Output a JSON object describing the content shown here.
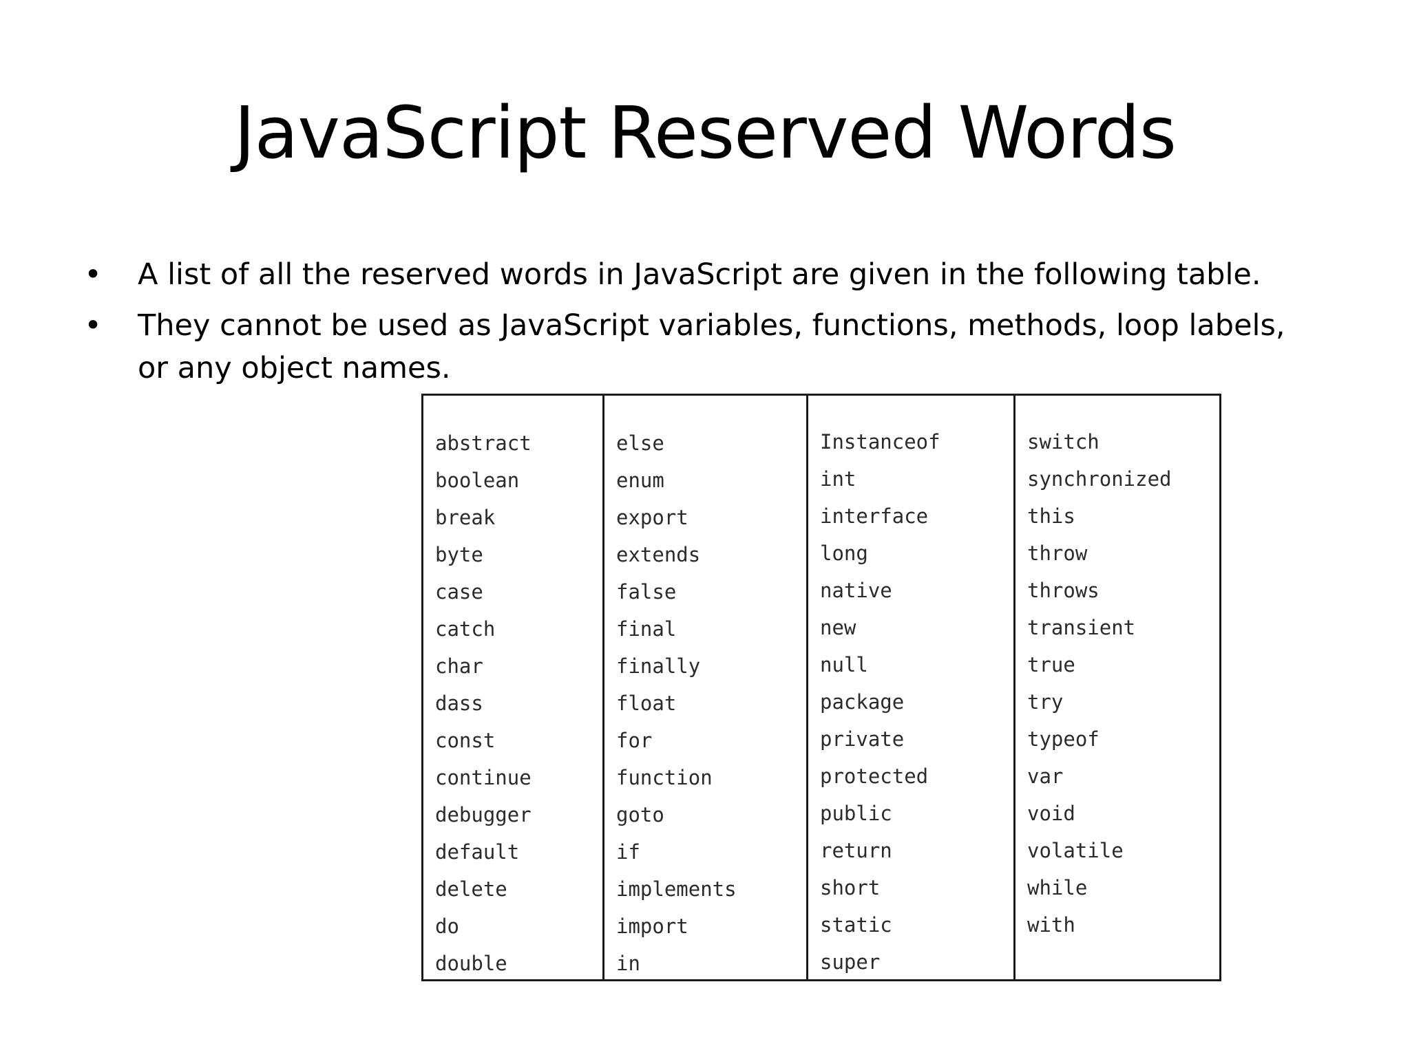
{
  "slide": {
    "title": "JavaScript Reserved Words",
    "bullets": [
      "A list of all the  reserved words in JavaScript  are given in the following table.",
      "They cannot be used as JavaScript variables, functions, methods, loop labels, or any object names."
    ],
    "bullet_symbol": "•"
  },
  "table": {
    "columns": [
      [
        "abstract",
        "boolean",
        "break",
        "byte",
        "case",
        "catch",
        "char",
        "dass",
        "const",
        "continue",
        "debugger",
        "default",
        "delete",
        "do",
        "double"
      ],
      [
        "else",
        "enum",
        "export",
        "extends",
        "false",
        "final",
        "finally",
        "float",
        "for",
        "function",
        "goto",
        "if",
        "implements",
        "import",
        "in"
      ],
      [
        "Instanceof",
        "int",
        "interface",
        "long",
        "native",
        "new",
        "null",
        "package",
        "private",
        "protected",
        "public",
        "return",
        "short",
        "static",
        "super"
      ],
      [
        "switch",
        "synchronized",
        "this",
        "throw",
        "throws",
        "transient",
        "true",
        "try",
        "typeof",
        "var",
        "void",
        "volatile",
        "while",
        "with"
      ]
    ]
  }
}
